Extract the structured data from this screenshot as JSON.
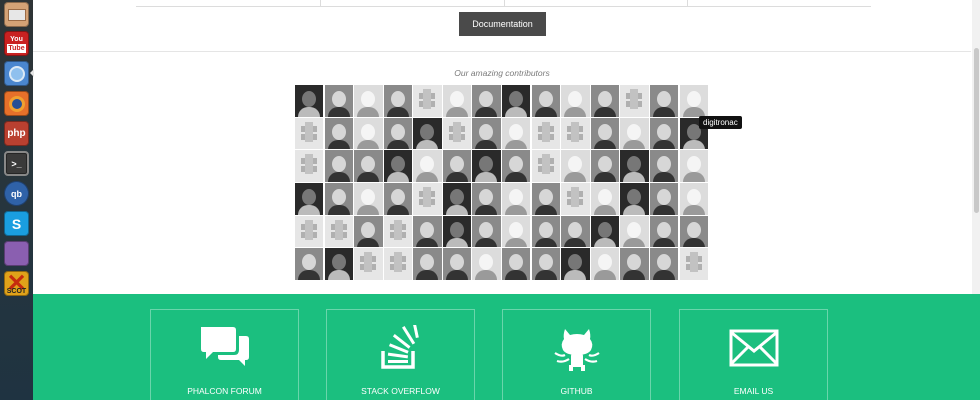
{
  "launcher": {
    "items": [
      {
        "name": "files",
        "color": "#c98c5a"
      },
      {
        "name": "youtube",
        "color": "#c31f1f",
        "text": "You\nTube"
      },
      {
        "name": "chromium",
        "color": "#3d7fd1"
      },
      {
        "name": "firefox",
        "color": "#e4671c"
      },
      {
        "name": "php",
        "color": "#b23b2d",
        "text": "php"
      },
      {
        "name": "terminal",
        "color": "#3a3a3a",
        "text": ">_"
      },
      {
        "name": "qbittorrent",
        "color": "#3f6fb0",
        "text": "qb"
      },
      {
        "name": "skype",
        "color": "#1a9ee0",
        "text": "S"
      },
      {
        "name": "app-purple",
        "color": "#8a5fb0"
      },
      {
        "name": "app-x",
        "color": "#e0a21a",
        "text": "SCOT"
      }
    ]
  },
  "content": {
    "documentation_label": "Documentation",
    "contributors_title": "Our amazing contributors",
    "tooltip": "digitronac"
  },
  "footer": {
    "cards": [
      {
        "label": "PHALCON FORUM",
        "icon": "chat-bubbles-icon"
      },
      {
        "label": "STACK OVERFLOW",
        "icon": "stack-overflow-icon"
      },
      {
        "label": "GITHUB",
        "icon": "github-octocat-icon"
      },
      {
        "label": "EMAIL US",
        "icon": "envelope-icon"
      }
    ]
  },
  "colors": {
    "footer": "#1bbf7f",
    "button": "#4a4a4a"
  }
}
